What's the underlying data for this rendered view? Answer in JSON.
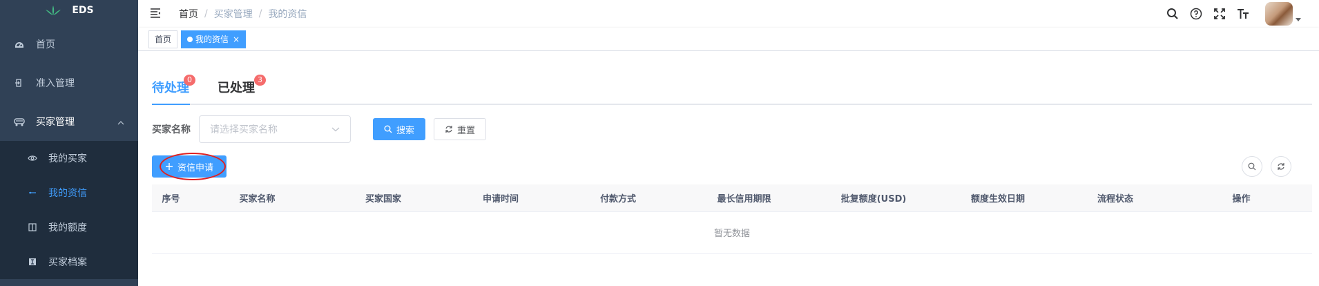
{
  "app": {
    "name": "EDS"
  },
  "sidebar": {
    "items": [
      {
        "label": "首页",
        "icon": "dashboard-icon"
      },
      {
        "label": "准入管理",
        "icon": "enter-icon"
      },
      {
        "label": "买家管理",
        "icon": "user-group-icon",
        "expanded": true,
        "children": [
          {
            "label": "我的买家",
            "icon": "eye-icon"
          },
          {
            "label": "我的资信",
            "icon": "link-icon",
            "active": true
          },
          {
            "label": "我的额度",
            "icon": "columns-icon"
          },
          {
            "label": "买家档案",
            "icon": "document-icon"
          }
        ]
      }
    ]
  },
  "navbar": {
    "breadcrumb": [
      "首页",
      "买家管理",
      "我的资信"
    ],
    "icons": [
      "search-icon",
      "help-icon",
      "fullscreen-icon",
      "font-size-icon"
    ]
  },
  "tags_view": {
    "tags": [
      {
        "label": "首页",
        "active": false
      },
      {
        "label": "我的资信",
        "active": true
      }
    ]
  },
  "tabs": [
    {
      "label": "待处理",
      "badge": "0",
      "active": true
    },
    {
      "label": "已处理",
      "badge": "3",
      "active": false
    }
  ],
  "search": {
    "label": "买家名称",
    "placeholder": "请选择买家名称",
    "search_button": "搜索",
    "reset_button": "重置"
  },
  "toolbar": {
    "add_button": "资信申请"
  },
  "table": {
    "columns": [
      "序号",
      "买家名称",
      "买家国家",
      "申请时间",
      "付款方式",
      "最长信用期限",
      "批复额度(USD)",
      "额度生效日期",
      "流程状态",
      "操作"
    ],
    "rows": [],
    "empty_text": "暂无数据"
  },
  "colors": {
    "sidebar_bg": "#304156",
    "submenu_bg": "#1f2d3d",
    "primary": "#409eff",
    "badge": "#f56c6c",
    "annotation": "#e02020"
  }
}
